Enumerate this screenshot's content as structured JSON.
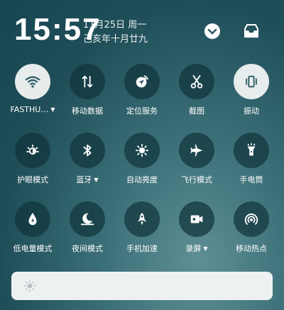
{
  "status": {
    "time": "15:57",
    "date_line1": "11月25日 周一",
    "date_line2": "己亥年十月廿九"
  },
  "header_buttons": {
    "expand_icon": "chevron-down-circle-icon",
    "inbox_icon": "inbox-icon"
  },
  "tiles": [
    {
      "label": "FASTHU…",
      "has_caret": true,
      "icon": "wifi-icon",
      "active": true
    },
    {
      "label": "移动数据",
      "has_caret": false,
      "icon": "mobile-data-icon",
      "active": false
    },
    {
      "label": "定位服务",
      "has_caret": false,
      "icon": "location-icon",
      "active": false
    },
    {
      "label": "截图",
      "has_caret": false,
      "icon": "screenshot-scissors-icon",
      "active": false
    },
    {
      "label": "振动",
      "has_caret": false,
      "icon": "vibrate-icon",
      "active": true
    },
    {
      "label": "护眼模式",
      "has_caret": false,
      "icon": "eye-protect-icon",
      "active": false
    },
    {
      "label": "蓝牙",
      "has_caret": true,
      "icon": "bluetooth-icon",
      "active": false
    },
    {
      "label": "自动亮度",
      "has_caret": false,
      "icon": "auto-brightness-icon",
      "active": false
    },
    {
      "label": "飞行模式",
      "has_caret": false,
      "icon": "airplane-icon",
      "active": false
    },
    {
      "label": "手电筒",
      "has_caret": false,
      "icon": "flashlight-icon",
      "active": false
    },
    {
      "label": "低电量模式",
      "has_caret": false,
      "icon": "battery-saver-icon",
      "active": false
    },
    {
      "label": "夜间模式",
      "has_caret": false,
      "icon": "night-mode-icon",
      "active": false
    },
    {
      "label": "手机加速",
      "has_caret": false,
      "icon": "rocket-icon",
      "active": false
    },
    {
      "label": "录屏",
      "has_caret": true,
      "icon": "screen-record-icon",
      "active": false
    },
    {
      "label": "移动热点",
      "has_caret": false,
      "icon": "hotspot-icon",
      "active": false
    }
  ],
  "brightness": {
    "icon": "brightness-sun-icon",
    "level": 0.0
  },
  "colors": {
    "tile_off": "#10343c",
    "tile_on": "#e7ecec",
    "icon_on": "#2a5a62",
    "text": "#ffffff"
  }
}
